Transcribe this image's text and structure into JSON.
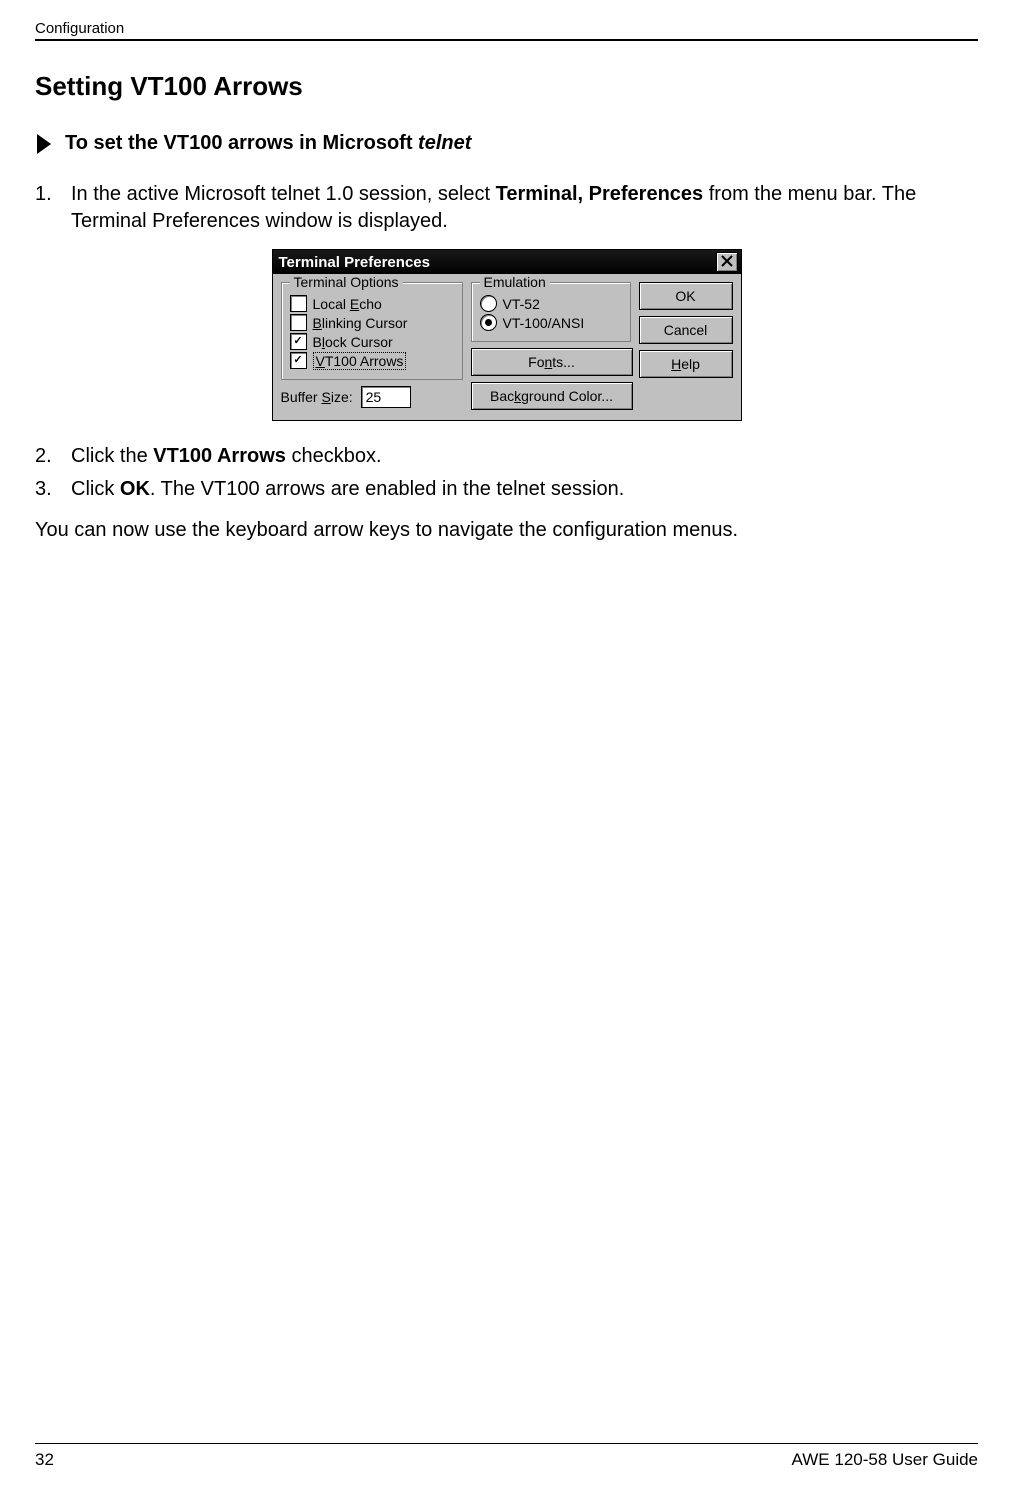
{
  "header": {
    "label": "Configuration"
  },
  "section": {
    "title": "Setting VT100 Arrows"
  },
  "task": {
    "prefix": "To set the VT100 arrows in Microsoft ",
    "italic": "telnet"
  },
  "steps": {
    "s1_num": "1.",
    "s1_a": "In the active Microsoft telnet 1.0 session, select ",
    "s1_b": "Terminal, Preferences",
    "s1_c": " from the menu bar. The Terminal Preferences window is displayed.",
    "s2_num": "2.",
    "s2_a": "Click the ",
    "s2_b": "VT100 Arrows",
    "s2_c": " checkbox.",
    "s3_num": "3.",
    "s3_a": "Click ",
    "s3_b": "OK",
    "s3_c": ". The VT100 arrows are enabled in the telnet session."
  },
  "para": "You can now use the keyboard arrow keys to navigate the configuration menus.",
  "dialog": {
    "title": "Terminal Preferences",
    "group_terminal": "Terminal Options",
    "opt_local_pre": "Local ",
    "opt_local_u": "E",
    "opt_local_post": "cho",
    "opt_blink_u": "B",
    "opt_blink_post": "linking Cursor",
    "opt_block_pre": "B",
    "opt_block_u": "l",
    "opt_block_post": "ock Cursor",
    "opt_vt_u": "V",
    "opt_vt_post": "T100 Arrows",
    "buffer_pre": "Buffer ",
    "buffer_u": "S",
    "buffer_post": "ize:",
    "buffer_value": "25",
    "group_emulation": "Emulation",
    "radio_vt52": "VT-52",
    "radio_vt100": "VT-100/ANSI",
    "fonts_pre": "Fo",
    "fonts_u": "n",
    "fonts_post": "ts...",
    "bg_pre": "Bac",
    "bg_u": "k",
    "bg_post": "ground Color...",
    "btn_ok": "OK",
    "btn_cancel": "Cancel",
    "btn_help_u": "H",
    "btn_help_post": "elp"
  },
  "footer": {
    "page": "32",
    "guide": "AWE 120-58 User Guide"
  }
}
